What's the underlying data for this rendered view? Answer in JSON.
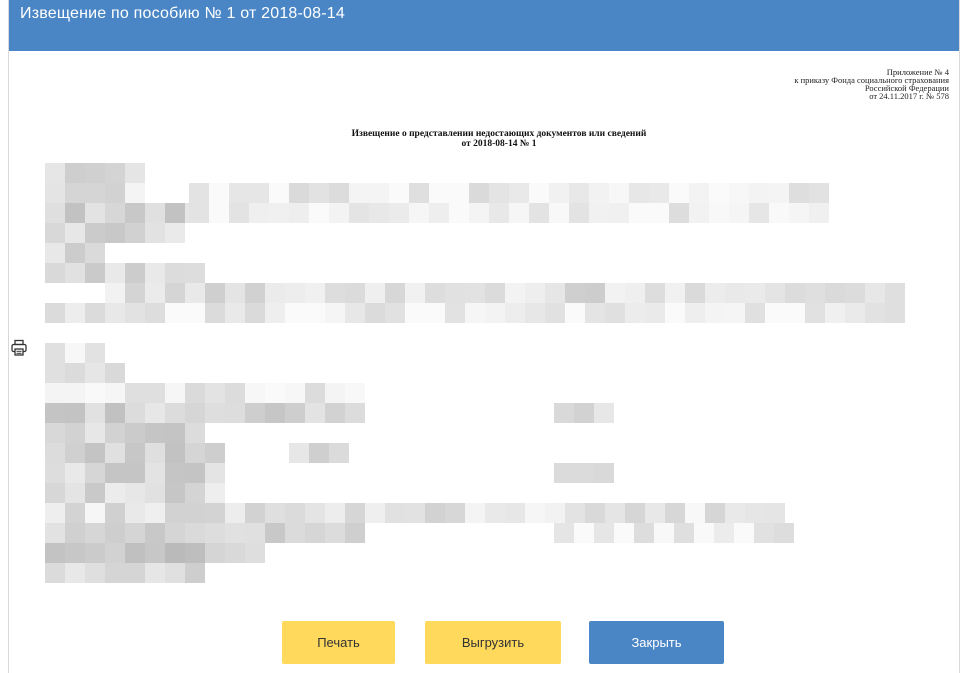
{
  "window": {
    "title": "Извещение по пособию № 1 от 2018-08-14"
  },
  "document": {
    "appendix": {
      "line1": "Приложение № 4",
      "line2": "к приказу Фонда социального страхования",
      "line3": "Российской Федерации",
      "line4": "от 24.11.2017 г. № 578"
    },
    "heading": {
      "line1": "Извещение о представлении недостающих документов или сведений",
      "line2": "от 2018-08-14 № 1"
    }
  },
  "icons": {
    "print": "printer-icon"
  },
  "buttons": {
    "print_label": "Печать",
    "export_label": "Выгрузить",
    "close_label": "Закрыть"
  },
  "colors": {
    "title_bar": "#4a86c5",
    "button_yellow": "#ffd95c",
    "button_blue": "#4a86c5"
  }
}
